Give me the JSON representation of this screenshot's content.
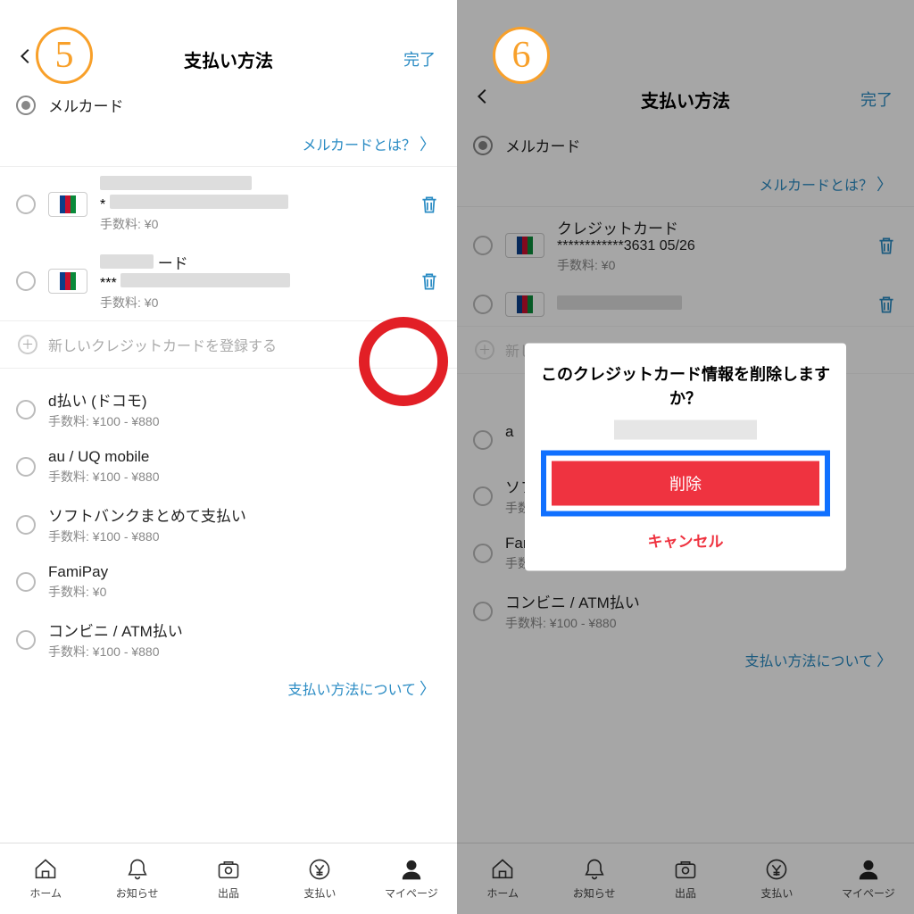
{
  "steps": {
    "five": "5",
    "six": "6"
  },
  "header": {
    "title": "支払い方法",
    "done": "完了"
  },
  "mercard": {
    "label": "メルカード",
    "info_link": "メルカードとは？"
  },
  "cards_s5": [
    {
      "fee": "手数料: ¥0"
    },
    {
      "fee": "手数料: ¥0"
    }
  ],
  "card_s6": {
    "type": "クレジットカード",
    "number": "************3631 05/26",
    "fee": "手数料: ¥0"
  },
  "add_card": "新しいクレジットカードを登録する",
  "carriers": [
    {
      "name": "d払い (ドコモ)",
      "fee": "手数料: ¥100 - ¥880"
    },
    {
      "name": "au / UQ mobile",
      "fee": "手数料: ¥100 - ¥880"
    },
    {
      "name": "ソフトバンクまとめて支払い",
      "fee": "手数料: ¥100 - ¥880"
    },
    {
      "name": "FamiPay",
      "fee": "手数料: ¥0"
    },
    {
      "name": "コンビニ / ATM払い",
      "fee": "手数料: ¥100 - ¥880"
    }
  ],
  "about_link": "支払い方法について",
  "s6_partial": "a",
  "dialog": {
    "title": "このクレジットカード情報を削除しますか？",
    "delete": "削除",
    "cancel": "キャンセル"
  },
  "tabs": {
    "home": "ホーム",
    "news": "お知らせ",
    "sell": "出品",
    "pay": "支払い",
    "mypage": "マイページ"
  }
}
